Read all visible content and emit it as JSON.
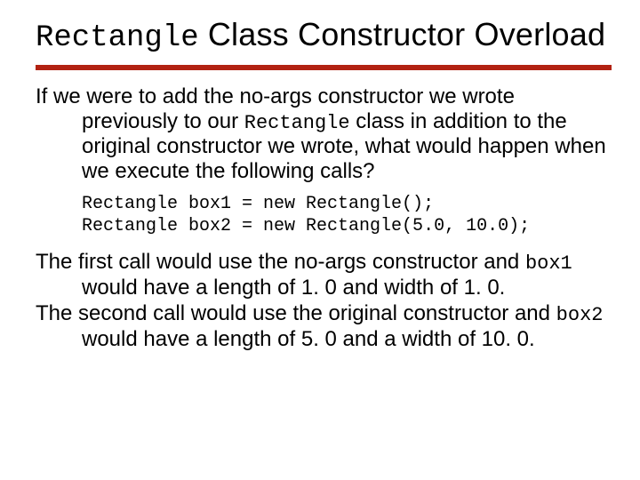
{
  "title": {
    "mono": "Rectangle",
    "rest": " Class Constructor Overload"
  },
  "p1": {
    "a": "If we were to add the no-args constructor we wrote previously to our ",
    "mono": "Rectangle",
    "b": " class in addition to the original constructor we wrote, what would happen when we execute the following calls?"
  },
  "code": "Rectangle box1 = new Rectangle();\nRectangle box2 = new Rectangle(5.0, 10.0);",
  "p2": {
    "a": "The first call would use the no-args constructor and ",
    "mono": "box1",
    "b": " would have a length of 1. 0 and width of 1. 0."
  },
  "p3": {
    "a": "The second call would use the original constructor and ",
    "mono": "box2",
    "b": " would have a length of 5. 0 and a width of 10. 0."
  }
}
